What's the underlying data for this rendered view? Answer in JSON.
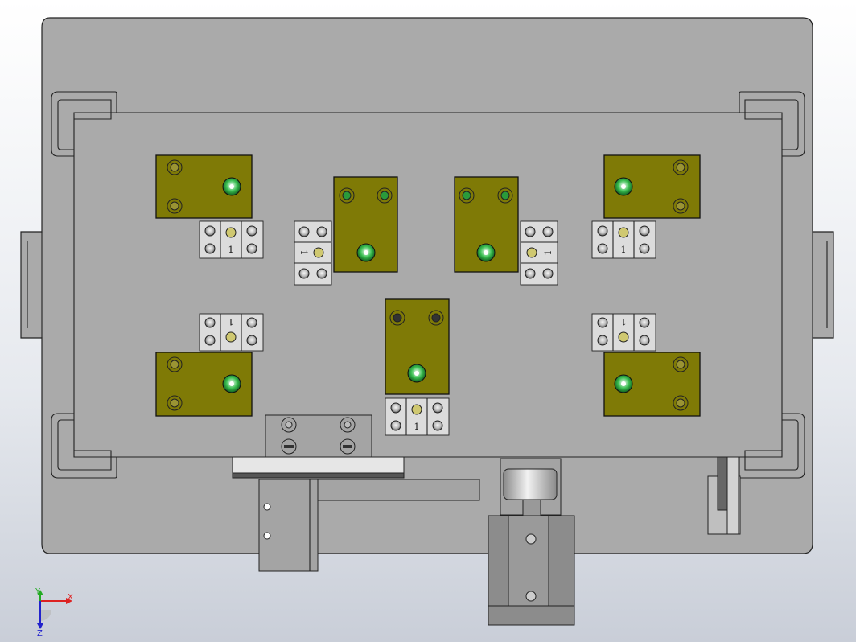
{
  "fixture": {
    "block_labels": [
      "1",
      "1",
      "1",
      "1",
      "1",
      "1",
      "1"
    ]
  },
  "triad": {
    "x_label": "X",
    "y_label": "Y",
    "z_label": "Z"
  },
  "colors": {
    "pad": "#7f7a06",
    "plate": "#aaaaaa",
    "bolt_green": "#1d8a2f"
  }
}
